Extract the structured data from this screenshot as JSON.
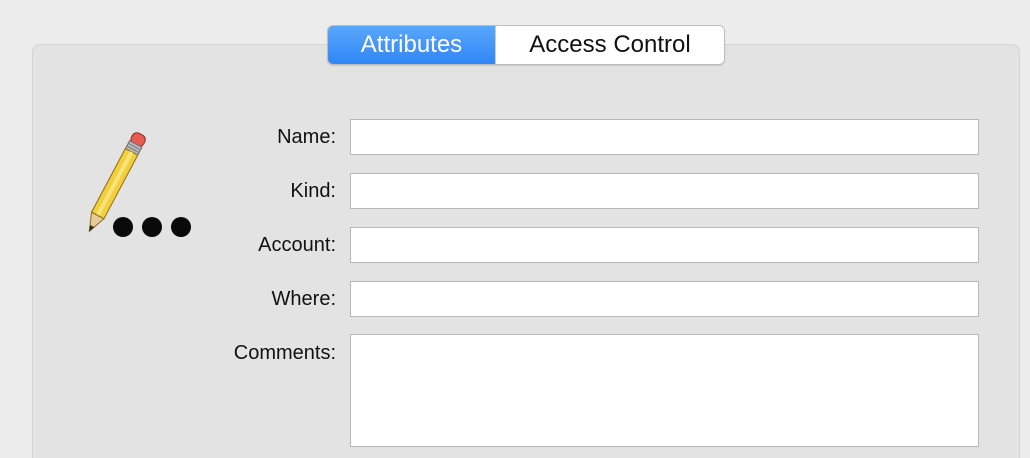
{
  "tabs": [
    {
      "label": "Attributes",
      "active": true
    },
    {
      "label": "Access Control",
      "active": false
    }
  ],
  "form": {
    "name_label": "Name:",
    "kind_label": "Kind:",
    "account_label": "Account:",
    "where_label": "Where:",
    "comments_label": "Comments:",
    "name_value": "",
    "kind_value": "",
    "account_value": "",
    "where_value": "",
    "comments_value": ""
  },
  "icon": "pencil-password-icon",
  "colors": {
    "accent": "#3b8ff7",
    "panel_bg": "#e3e3e3",
    "window_bg": "#ececec"
  }
}
